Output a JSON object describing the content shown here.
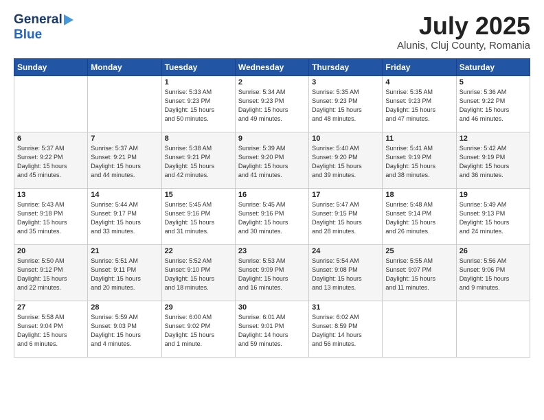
{
  "header": {
    "logo_general": "General",
    "logo_blue": "Blue",
    "month_title": "July 2025",
    "location": "Alunis, Cluj County, Romania"
  },
  "weekdays": [
    "Sunday",
    "Monday",
    "Tuesday",
    "Wednesday",
    "Thursday",
    "Friday",
    "Saturday"
  ],
  "weeks": [
    [
      {
        "day": "",
        "info": ""
      },
      {
        "day": "",
        "info": ""
      },
      {
        "day": "1",
        "info": "Sunrise: 5:33 AM\nSunset: 9:23 PM\nDaylight: 15 hours\nand 50 minutes."
      },
      {
        "day": "2",
        "info": "Sunrise: 5:34 AM\nSunset: 9:23 PM\nDaylight: 15 hours\nand 49 minutes."
      },
      {
        "day": "3",
        "info": "Sunrise: 5:35 AM\nSunset: 9:23 PM\nDaylight: 15 hours\nand 48 minutes."
      },
      {
        "day": "4",
        "info": "Sunrise: 5:35 AM\nSunset: 9:23 PM\nDaylight: 15 hours\nand 47 minutes."
      },
      {
        "day": "5",
        "info": "Sunrise: 5:36 AM\nSunset: 9:22 PM\nDaylight: 15 hours\nand 46 minutes."
      }
    ],
    [
      {
        "day": "6",
        "info": "Sunrise: 5:37 AM\nSunset: 9:22 PM\nDaylight: 15 hours\nand 45 minutes."
      },
      {
        "day": "7",
        "info": "Sunrise: 5:37 AM\nSunset: 9:21 PM\nDaylight: 15 hours\nand 44 minutes."
      },
      {
        "day": "8",
        "info": "Sunrise: 5:38 AM\nSunset: 9:21 PM\nDaylight: 15 hours\nand 42 minutes."
      },
      {
        "day": "9",
        "info": "Sunrise: 5:39 AM\nSunset: 9:20 PM\nDaylight: 15 hours\nand 41 minutes."
      },
      {
        "day": "10",
        "info": "Sunrise: 5:40 AM\nSunset: 9:20 PM\nDaylight: 15 hours\nand 39 minutes."
      },
      {
        "day": "11",
        "info": "Sunrise: 5:41 AM\nSunset: 9:19 PM\nDaylight: 15 hours\nand 38 minutes."
      },
      {
        "day": "12",
        "info": "Sunrise: 5:42 AM\nSunset: 9:19 PM\nDaylight: 15 hours\nand 36 minutes."
      }
    ],
    [
      {
        "day": "13",
        "info": "Sunrise: 5:43 AM\nSunset: 9:18 PM\nDaylight: 15 hours\nand 35 minutes."
      },
      {
        "day": "14",
        "info": "Sunrise: 5:44 AM\nSunset: 9:17 PM\nDaylight: 15 hours\nand 33 minutes."
      },
      {
        "day": "15",
        "info": "Sunrise: 5:45 AM\nSunset: 9:16 PM\nDaylight: 15 hours\nand 31 minutes."
      },
      {
        "day": "16",
        "info": "Sunrise: 5:45 AM\nSunset: 9:16 PM\nDaylight: 15 hours\nand 30 minutes."
      },
      {
        "day": "17",
        "info": "Sunrise: 5:47 AM\nSunset: 9:15 PM\nDaylight: 15 hours\nand 28 minutes."
      },
      {
        "day": "18",
        "info": "Sunrise: 5:48 AM\nSunset: 9:14 PM\nDaylight: 15 hours\nand 26 minutes."
      },
      {
        "day": "19",
        "info": "Sunrise: 5:49 AM\nSunset: 9:13 PM\nDaylight: 15 hours\nand 24 minutes."
      }
    ],
    [
      {
        "day": "20",
        "info": "Sunrise: 5:50 AM\nSunset: 9:12 PM\nDaylight: 15 hours\nand 22 minutes."
      },
      {
        "day": "21",
        "info": "Sunrise: 5:51 AM\nSunset: 9:11 PM\nDaylight: 15 hours\nand 20 minutes."
      },
      {
        "day": "22",
        "info": "Sunrise: 5:52 AM\nSunset: 9:10 PM\nDaylight: 15 hours\nand 18 minutes."
      },
      {
        "day": "23",
        "info": "Sunrise: 5:53 AM\nSunset: 9:09 PM\nDaylight: 15 hours\nand 16 minutes."
      },
      {
        "day": "24",
        "info": "Sunrise: 5:54 AM\nSunset: 9:08 PM\nDaylight: 15 hours\nand 13 minutes."
      },
      {
        "day": "25",
        "info": "Sunrise: 5:55 AM\nSunset: 9:07 PM\nDaylight: 15 hours\nand 11 minutes."
      },
      {
        "day": "26",
        "info": "Sunrise: 5:56 AM\nSunset: 9:06 PM\nDaylight: 15 hours\nand 9 minutes."
      }
    ],
    [
      {
        "day": "27",
        "info": "Sunrise: 5:58 AM\nSunset: 9:04 PM\nDaylight: 15 hours\nand 6 minutes."
      },
      {
        "day": "28",
        "info": "Sunrise: 5:59 AM\nSunset: 9:03 PM\nDaylight: 15 hours\nand 4 minutes."
      },
      {
        "day": "29",
        "info": "Sunrise: 6:00 AM\nSunset: 9:02 PM\nDaylight: 15 hours\nand 1 minute."
      },
      {
        "day": "30",
        "info": "Sunrise: 6:01 AM\nSunset: 9:01 PM\nDaylight: 14 hours\nand 59 minutes."
      },
      {
        "day": "31",
        "info": "Sunrise: 6:02 AM\nSunset: 8:59 PM\nDaylight: 14 hours\nand 56 minutes."
      },
      {
        "day": "",
        "info": ""
      },
      {
        "day": "",
        "info": ""
      }
    ]
  ]
}
